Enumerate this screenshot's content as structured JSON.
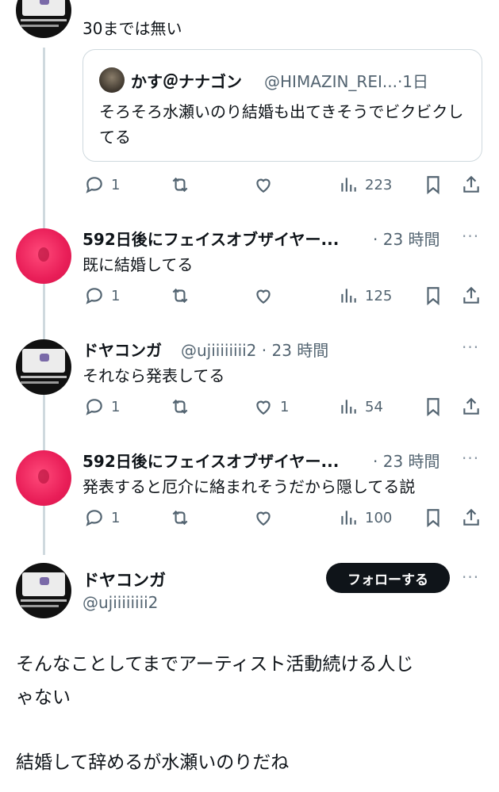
{
  "top_tweet": {
    "text": "30までは無い",
    "quote": {
      "name": "かす＠ナナゴン",
      "meta": "@HIMAZIN_REI...·1日",
      "text": "そろそろ水瀬いのり結婚も出てきそうでビクビクしてる"
    },
    "replies": "1",
    "views": "223"
  },
  "replies": [
    {
      "avatar": "pink",
      "name": "592日後にフェイスオブザイヤー...",
      "meta": "· 23 時間",
      "text": "既に結婚してる",
      "reply_count": "1",
      "like_count": "",
      "views": "125"
    },
    {
      "avatar": "black",
      "name": "ドヤコンガ",
      "meta": "@ujiiiiiiii2 · 23 時間",
      "text": "それなら発表してる",
      "reply_count": "1",
      "like_count": "1",
      "views": "54"
    },
    {
      "avatar": "pink",
      "name": "592日後にフェイスオブザイヤー...",
      "meta": "· 23 時間",
      "text": "発表すると厄介に絡まれそうだから隠してる説",
      "reply_count": "1",
      "like_count": "",
      "views": "100"
    }
  ],
  "main_tweet": {
    "name": "ドヤコンガ",
    "handle": "@ujiiiiiiii2",
    "follow_label": "フォローする",
    "text_line1": "そんなことしてまでアーティスト活動続ける人じ",
    "text_line2": "ゃない",
    "text_line3": "結婚して辞めるが水瀬いのりだね"
  },
  "icons": [
    "reply-icon",
    "retweet-icon",
    "like-icon",
    "views-icon",
    "bookmark-icon",
    "share-icon",
    "more-icon"
  ],
  "colors": {
    "follow_button": "#0f1419",
    "thread_line": "#cfd9de",
    "muted": "#536471"
  }
}
